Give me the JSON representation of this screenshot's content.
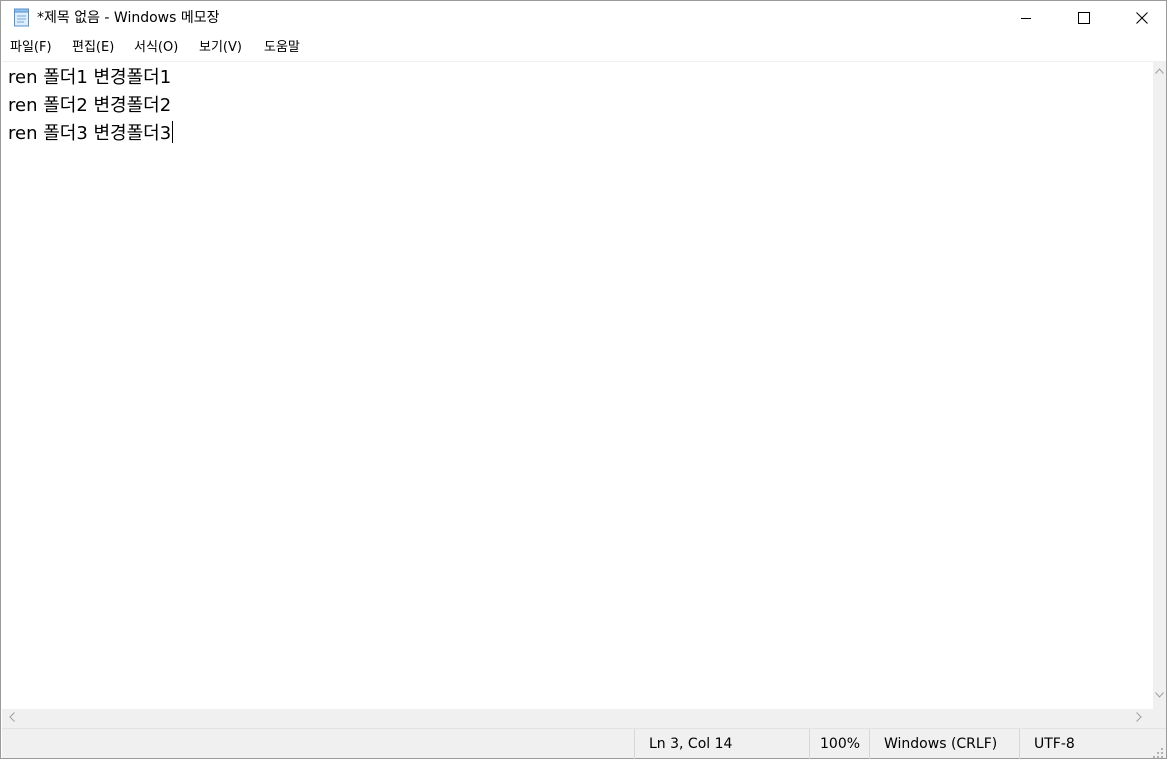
{
  "window": {
    "title": "*제목 없음 - Windows 메모장",
    "app_icon": "notepad-icon",
    "controls": [
      "minimize-icon",
      "maximize-icon",
      "close-icon"
    ]
  },
  "menu": {
    "items": [
      {
        "label": "파일(F)"
      },
      {
        "label": "편집(E)"
      },
      {
        "label": "서식(O)"
      },
      {
        "label": "보기(V)"
      },
      {
        "label": "도움말"
      }
    ]
  },
  "editor": {
    "lines": [
      "ren 폴더1 변경폴더1",
      "ren 폴더2 변경폴더2",
      "ren 폴더3 변경폴더3"
    ]
  },
  "scrollbars": {
    "icons": [
      "chevron-up-icon",
      "chevron-down-icon",
      "chevron-left-icon",
      "chevron-right-icon"
    ]
  },
  "status": {
    "position": "Ln 3, Col 14",
    "zoom": "100%",
    "line_ending": "Windows (CRLF)",
    "encoding": "UTF-8"
  },
  "colors": {
    "chrome": "#f0f0f0",
    "border": "#9a9a9a",
    "scroll_arrow": "#a0a0a0"
  }
}
